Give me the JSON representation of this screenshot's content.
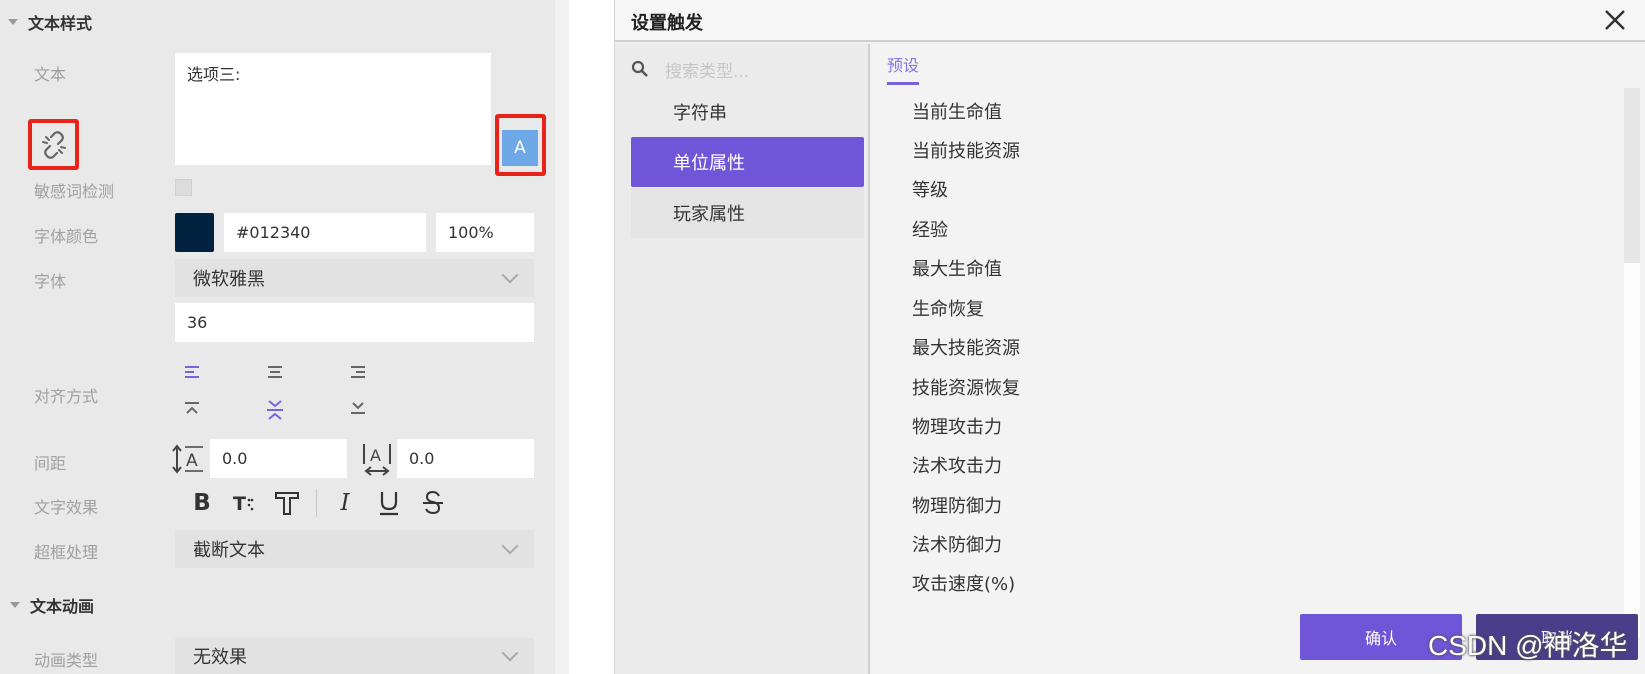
{
  "left": {
    "text_style_header": "文本样式",
    "text_label": "文本",
    "text_value": "选项三:",
    "text_button_letter": "A",
    "sensitive_label": "敏感词检测",
    "font_color_label": "字体颜色",
    "font_color_swatch": "#012340",
    "font_color_hex": "#012340",
    "font_color_opacity": "100%",
    "font_label": "字体",
    "font_value": "微软雅黑",
    "font_size": "36",
    "align_label": "对齐方式",
    "spacing_label": "间距",
    "line_spacing": "0.0",
    "letter_spacing": "0.0",
    "text_effect_label": "文字效果",
    "overflow_label": "超框处理",
    "overflow_value": "截断文本",
    "text_anim_header": "文本动画",
    "anim_type_label": "动画类型",
    "anim_type_value": "无效果"
  },
  "dialog": {
    "title": "设置触发",
    "search_placeholder": "搜索类型...",
    "categories": [
      "字符串",
      "单位属性",
      "玩家属性"
    ],
    "active_category": "单位属性",
    "tab_label": "预设",
    "items": [
      "当前生命值",
      "当前技能资源",
      "等级",
      "经验",
      "最大生命值",
      "生命恢复",
      "最大技能资源",
      "技能资源恢复",
      "物理攻击力",
      "法术攻击力",
      "物理防御力",
      "法术防御力",
      "攻击速度(%)"
    ],
    "confirm_label": "确认",
    "cancel_label": "取消"
  },
  "watermark": "CSDN @神洛华",
  "colors": {
    "accent": "#6f56d9",
    "highlight_red": "#e8231a",
    "text_button_blue": "#6ea8e6"
  }
}
